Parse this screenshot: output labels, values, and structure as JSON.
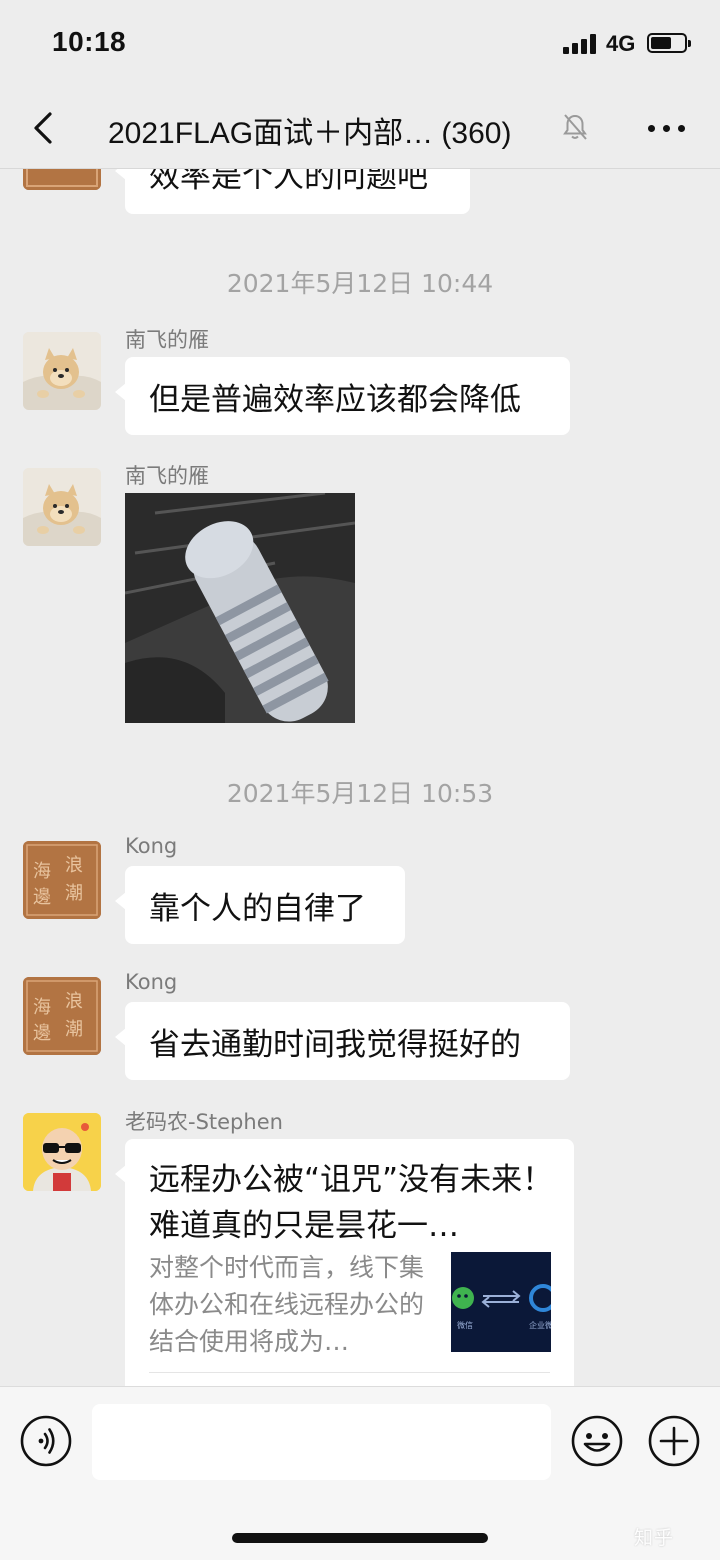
{
  "status_bar": {
    "time": "10:18",
    "network": "4G"
  },
  "nav": {
    "title": "2021FLAG面试＋内部… (360)"
  },
  "messages": {
    "partial_top": {
      "text": "效率是个人的问题吧"
    },
    "ts1": "2021年5月12日 10:44",
    "m1": {
      "sender": "南飞的雁",
      "text": "但是普遍效率应该都会降低"
    },
    "m2": {
      "sender": "南飞的雁"
    },
    "ts2": "2021年5月12日 10:53",
    "m3": {
      "sender": "Kong",
      "text": "靠个人的自律了"
    },
    "m4": {
      "sender": "Kong",
      "text": "省去通勤时间我觉得挺好的"
    },
    "m5": {
      "sender": "老码农-Stephen",
      "card_title": "远程办公被“诅咒”没有未来！难道真的只是昙花一…",
      "card_desc": "对整个时代而言，线下集体办公和在线远程办公的结合使用将成为…",
      "thumb_left_label": "微信",
      "thumb_right_label": "企业微"
    }
  },
  "avatars": {
    "seal_text": "海邊 浪潮"
  },
  "watermark": "知乎",
  "colors": {
    "background": "#ededed",
    "bubble": "#ffffff",
    "meta_text": "#a3a3a3"
  }
}
